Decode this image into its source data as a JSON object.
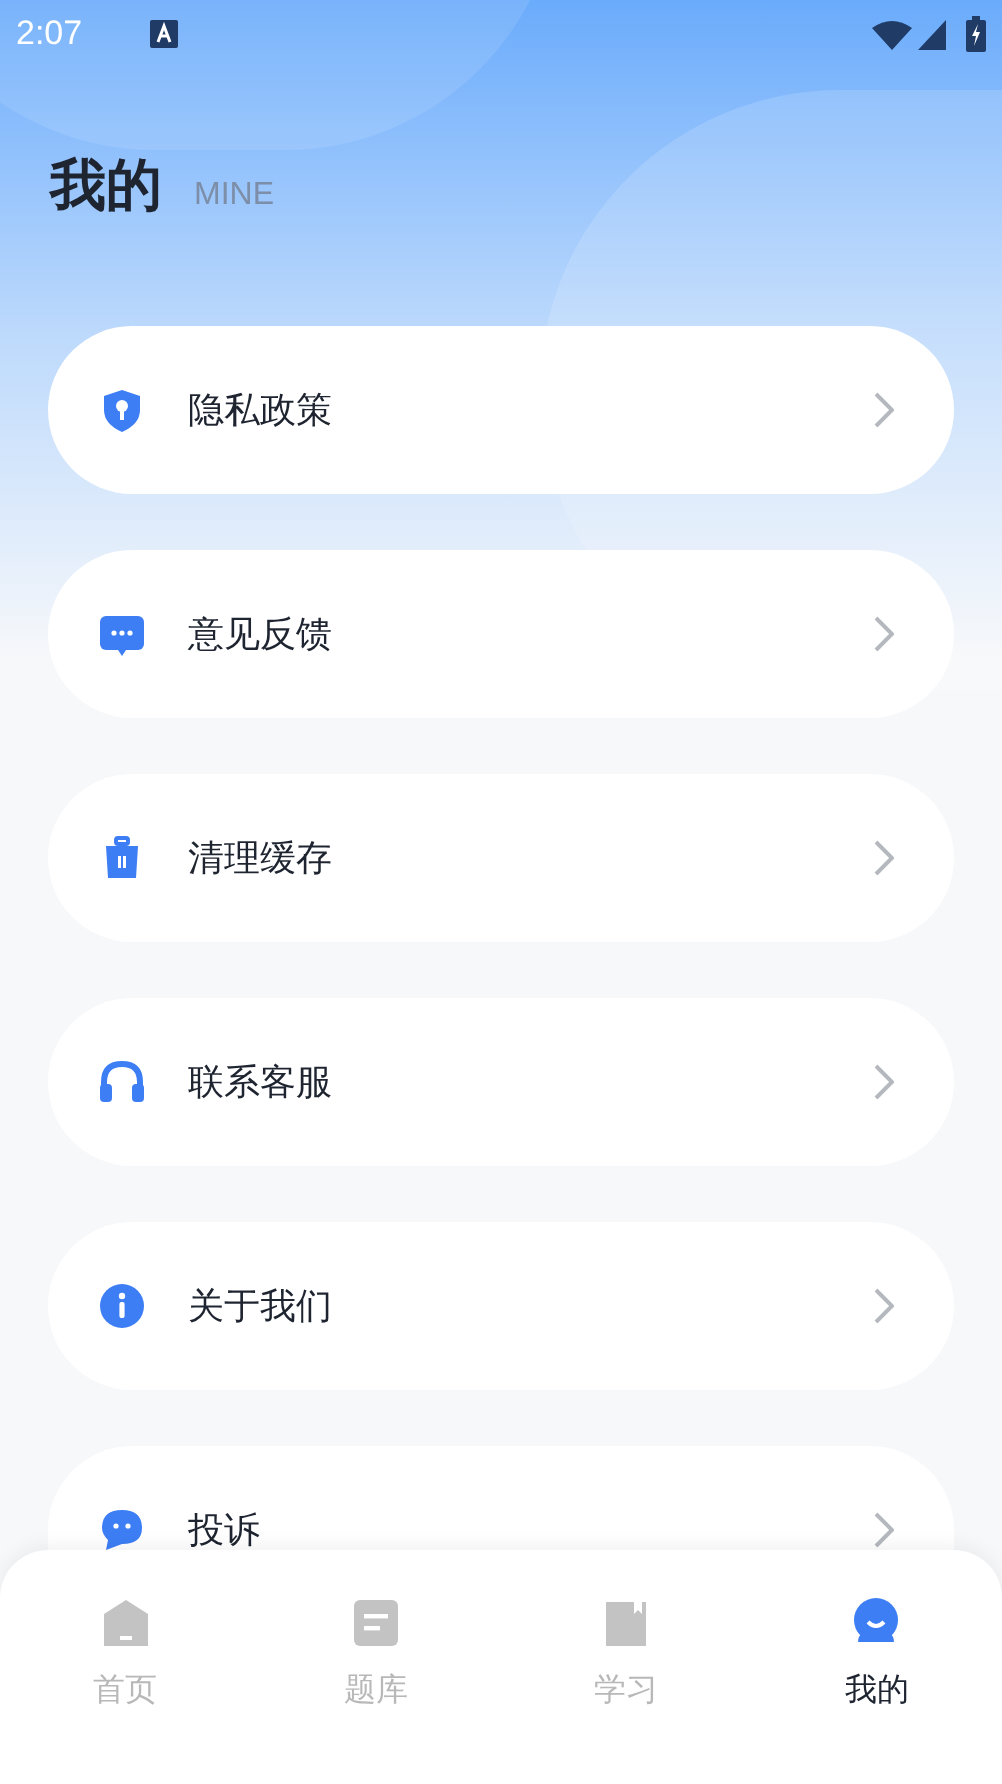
{
  "status_bar": {
    "time": "2:07"
  },
  "header": {
    "title": "我的",
    "subtitle": "MINE"
  },
  "menu": [
    {
      "kind": "privacy",
      "label": "隐私政策"
    },
    {
      "kind": "feedback",
      "label": "意见反馈"
    },
    {
      "kind": "cache",
      "label": "清理缓存"
    },
    {
      "kind": "service",
      "label": "联系客服"
    },
    {
      "kind": "about",
      "label": "关于我们"
    },
    {
      "kind": "complaint",
      "label": "投诉"
    }
  ],
  "tabs": [
    {
      "kind": "home",
      "label": "首页",
      "selected": false
    },
    {
      "kind": "bank",
      "label": "题库",
      "selected": false
    },
    {
      "kind": "study",
      "label": "学习",
      "selected": false
    },
    {
      "kind": "mine",
      "label": "我的",
      "selected": true
    }
  ]
}
